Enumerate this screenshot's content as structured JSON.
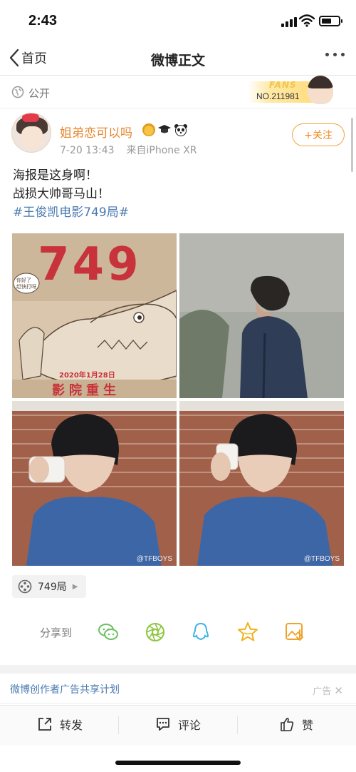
{
  "status_bar": {
    "time": "2:43",
    "battery_level": 0.6
  },
  "nav": {
    "back_label": "首页",
    "title": "微博正文"
  },
  "visibility": {
    "label": "公开"
  },
  "fans_badge": {
    "label": "FANS",
    "number": "NO.211981"
  },
  "author": {
    "name": "姐弟恋可以吗",
    "time": "7-20 13:43",
    "source": "来自iPhone XR",
    "badges": [
      "crown-badge-icon",
      "graduation-cap-icon",
      "panda-icon"
    ]
  },
  "follow": {
    "label": "+关注"
  },
  "post": {
    "lines": [
      "海报是这身啊！",
      "战损大帅哥马山！"
    ],
    "topic": "#王俊凯电影749局#"
  },
  "images": {
    "poster_title": "749",
    "poster_bubble": "你好了\n赶快打呀",
    "poster_date": "2020年1月28日",
    "poster_tagline": "影院重生",
    "watermark": "@TFBOYS"
  },
  "topic_chip": {
    "label": "749局"
  },
  "share": {
    "label": "分享到",
    "targets": [
      "wechat-icon",
      "moments-icon",
      "qq-icon",
      "favorite-icon",
      "save-image-icon"
    ]
  },
  "ad": {
    "text": "微博创作者广告共享计划",
    "tag": "广告"
  },
  "toolbar": {
    "repost": "转发",
    "comment": "评论",
    "like": "赞"
  },
  "colors": {
    "accent": "#ee8a1e",
    "link": "#4a7ab0",
    "topic": "#4a7ab0"
  }
}
